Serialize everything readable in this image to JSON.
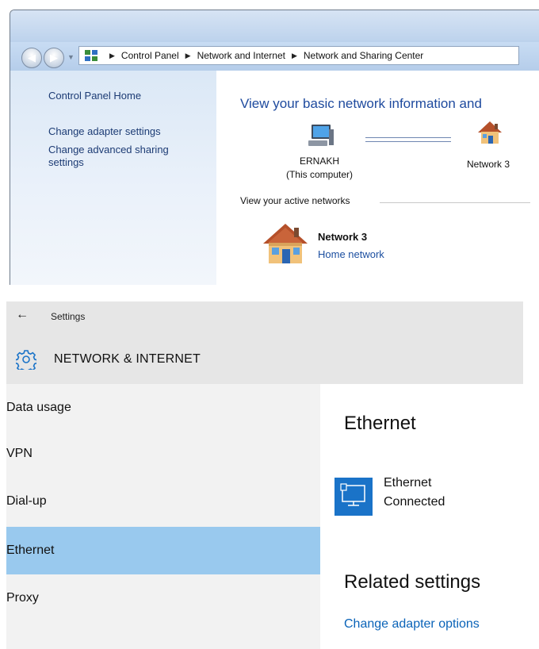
{
  "win7": {
    "address": {
      "crumbs": [
        "Control Panel",
        "Network and Internet",
        "Network and Sharing Center"
      ]
    },
    "left_pane": {
      "home": "Control Panel Home",
      "adapter": "Change adapter settings",
      "advanced_line1": "Change advanced sharing",
      "advanced_line2": "settings"
    },
    "main": {
      "title": "View your basic network information and",
      "computer_name": "ERNAKH",
      "computer_sub": "(This computer)",
      "network_name": "Network  3",
      "active_label": "View your active networks",
      "active_network_name": "Network  3",
      "active_network_type": "Home network"
    }
  },
  "win10": {
    "app_name": "Settings",
    "section": "NETWORK & INTERNET",
    "nav": [
      "Data usage",
      "VPN",
      "Dial-up",
      "Ethernet",
      "Proxy"
    ],
    "active_nav": "Ethernet",
    "content": {
      "title": "Ethernet",
      "adapter_name": "Ethernet",
      "adapter_status": "Connected",
      "related_title": "Related settings",
      "related_link": "Change adapter options"
    },
    "colors": {
      "active_nav": "#99c9ee",
      "tile": "#1a73c8",
      "link": "#0a63b8"
    }
  }
}
